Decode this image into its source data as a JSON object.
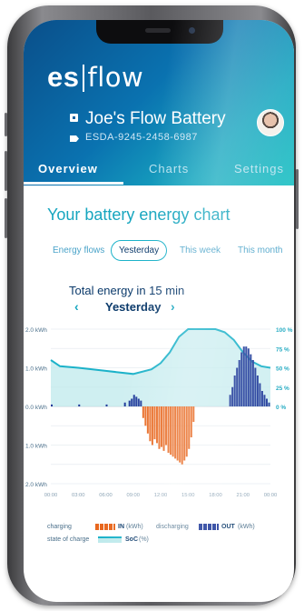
{
  "app": {
    "logo_left": "es",
    "logo_right": "flow",
    "battery_name": "Joe's Flow Battery",
    "battery_id": "ESDA-9245-2458-6987",
    "avatar_icon": "user-avatar"
  },
  "tabs": [
    {
      "label": "Overview",
      "active": true
    },
    {
      "label": "Charts",
      "active": false
    },
    {
      "label": "Settings",
      "active": false
    }
  ],
  "main": {
    "heading": "Your battery energy chart",
    "filters": [
      {
        "label": "Energy flows",
        "selected": false
      },
      {
        "label": "Yesterday",
        "selected": true
      },
      {
        "label": "This week",
        "selected": false
      },
      {
        "label": "This month",
        "selected": false
      }
    ],
    "chart_title": "Total energy in 15 min",
    "period_label": "Yesterday",
    "prev_icon": "chevron-left-icon",
    "next_icon": "chevron-right-icon"
  },
  "legend": {
    "charging_label": "charging",
    "in_label": "IN",
    "in_unit": "(kWh)",
    "discharging_label": "discharging",
    "out_label": "OUT",
    "out_unit": "(kWh)",
    "soc_label": "state of charge",
    "soc_name": "SoC",
    "soc_unit": "(%)"
  },
  "colors": {
    "header_start": "#0a4f8a",
    "header_end": "#1fc2c4",
    "accent": "#17a6bf",
    "charging": "#e8671e",
    "discharging": "#1f3a9a",
    "soc_line": "#1cb2c9",
    "soc_fill": "#bfeaec"
  },
  "chart_data": {
    "type": "bar",
    "title": "Total energy in 15 min",
    "y_left_ticks": [
      "2.0 kWh",
      "1.0 kWh",
      "0.0 kWh",
      "1.0 kWh",
      "2.0 kWh"
    ],
    "y_left_range_kwh": [
      -2,
      2
    ],
    "y_right_ticks": [
      "100 %",
      "75 %",
      "50 %",
      "25 %",
      "0 %"
    ],
    "x_ticks": [
      "00:00",
      "03:00",
      "06:00",
      "09:00",
      "12:00",
      "15:00",
      "18:00",
      "21:00",
      "00:00"
    ],
    "x_range_hours": [
      0,
      24
    ],
    "series": [
      {
        "name": "SoC",
        "type": "area",
        "unit": "%",
        "x": [
          0,
          1,
          3,
          6,
          9,
          11,
          12,
          13,
          14,
          15,
          16,
          18,
          19,
          20,
          21,
          22,
          23,
          24
        ],
        "values": [
          60,
          52,
          50,
          46,
          42,
          48,
          56,
          70,
          90,
          100,
          100,
          100,
          96,
          86,
          70,
          58,
          52,
          50
        ]
      },
      {
        "name": "OUT",
        "type": "bar",
        "unit": "kWh",
        "x": [
          0,
          3,
          6,
          8,
          8.5,
          8.75,
          9,
          9.25,
          9.5,
          9.75,
          19.5,
          19.75,
          20,
          20.25,
          20.5,
          20.75,
          21,
          21.25,
          21.5,
          21.75,
          22,
          22.25,
          22.5,
          22.75,
          23,
          23.25,
          23.5,
          23.75
        ],
        "values": [
          0.05,
          0.05,
          0.05,
          0.1,
          0.15,
          0.2,
          0.3,
          0.25,
          0.2,
          0.15,
          0.3,
          0.5,
          0.8,
          1.0,
          1.2,
          1.4,
          1.55,
          1.55,
          1.5,
          1.35,
          1.2,
          1.0,
          0.8,
          0.6,
          0.4,
          0.3,
          0.2,
          0.1
        ]
      },
      {
        "name": "IN",
        "type": "bar",
        "unit": "kWh",
        "x": [
          10,
          10.25,
          10.5,
          10.75,
          11,
          11.25,
          11.5,
          11.75,
          12,
          12.25,
          12.5,
          12.75,
          13,
          13.25,
          13.5,
          13.75,
          14,
          14.25,
          14.5,
          14.75,
          15,
          15.25,
          15.5
        ],
        "values": [
          -0.3,
          -0.5,
          -0.7,
          -0.9,
          -1.0,
          -0.85,
          -0.95,
          -1.1,
          -1.05,
          -1.15,
          -1.0,
          -1.2,
          -1.25,
          -1.3,
          -1.35,
          -1.4,
          -1.45,
          -1.5,
          -1.4,
          -1.3,
          -1.1,
          -0.8,
          -0.4
        ]
      }
    ],
    "grid": true
  }
}
